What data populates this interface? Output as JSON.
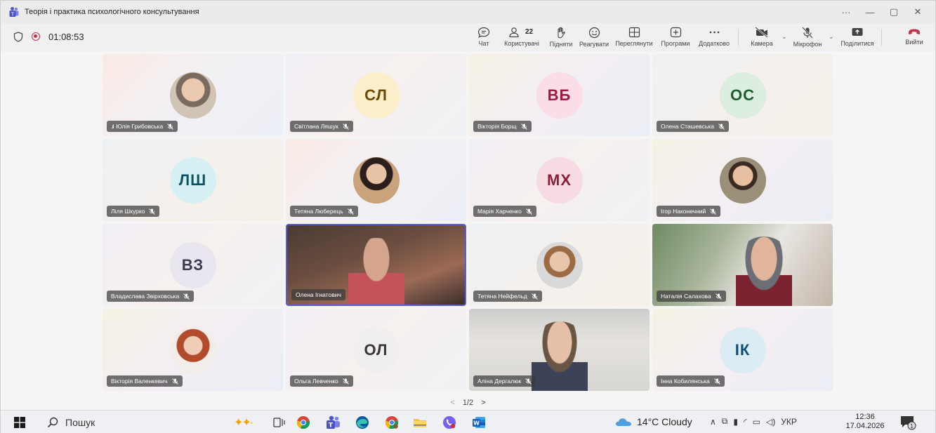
{
  "window": {
    "title": "Теорія і практика психологічного консультування",
    "controls": [
      "···",
      "—",
      "▢",
      "✕"
    ]
  },
  "meeting": {
    "timer": "01:08:53",
    "participants_count": "22",
    "toolbar": {
      "chat": "Чат",
      "people": "Користувачі",
      "raise": "Підняти",
      "react": "Реагувати",
      "view": "Переглянути",
      "apps": "Програми",
      "more": "Додатково",
      "camera": "Камера",
      "mic": "Мікрофон",
      "share": "Поділитися",
      "leave": "Вийти"
    },
    "colors": {
      "accent": "#5b5fc7",
      "leave": "#c4314b",
      "recording": "#c4314b"
    }
  },
  "tiles": [
    {
      "name": "Юлія Грибовська",
      "initials": "",
      "kind": "photo",
      "speaking": true
    },
    {
      "name": "Світлана Ляшук",
      "initials": "СЛ",
      "kind": "initials"
    },
    {
      "name": "Вікторія Борщ",
      "initials": "ВБ",
      "kind": "initials"
    },
    {
      "name": "Олена Сташевська",
      "initials": "ОС",
      "kind": "initials"
    },
    {
      "name": "Ліля Шкурко",
      "initials": "ЛШ",
      "kind": "initials"
    },
    {
      "name": "Тетяна Люберець",
      "initials": "",
      "kind": "photo"
    },
    {
      "name": "Марія Харченко",
      "initials": "МХ",
      "kind": "initials"
    },
    {
      "name": "Ігор Наконечний",
      "initials": "",
      "kind": "photo"
    },
    {
      "name": "Владислава Звірховська",
      "initials": "ВЗ",
      "kind": "initials"
    },
    {
      "name": "Олена Ігнатович",
      "initials": "",
      "kind": "video",
      "active": true
    },
    {
      "name": "Тетяна Нейфельд",
      "initials": "",
      "kind": "photo"
    },
    {
      "name": "Наталія Салахова",
      "initials": "",
      "kind": "video"
    },
    {
      "name": "Вікторія Валенкевич",
      "initials": "",
      "kind": "photo"
    },
    {
      "name": "Ольга Левченко",
      "initials": "ОЛ",
      "kind": "initials"
    },
    {
      "name": "Аліна Дергалюк",
      "initials": "",
      "kind": "video"
    },
    {
      "name": "Інна Кобилянська",
      "initials": "ІК",
      "kind": "initials"
    }
  ],
  "pager": {
    "label": "1/2",
    "prev": "<",
    "next": ">"
  },
  "taskbar": {
    "search_placeholder": "Пошук",
    "weather": "14°C  Cloudy",
    "language": "УКР",
    "time": "12:36",
    "date": "17.04.2026",
    "notifications": "1",
    "apps": [
      "task-view",
      "chrome",
      "teams",
      "edge",
      "chrome-profile",
      "file-explorer",
      "viber",
      "word"
    ]
  }
}
